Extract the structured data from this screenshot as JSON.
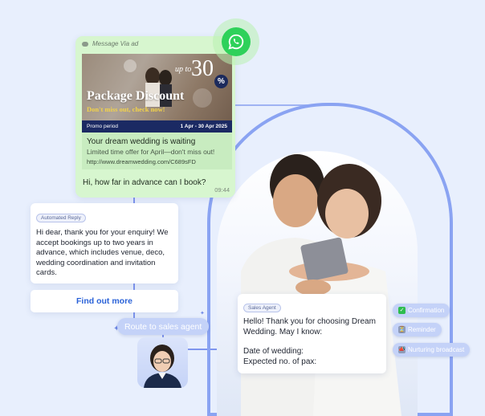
{
  "whatsapp_ad": {
    "header": "Message Via ad",
    "banner": {
      "up_to": "up to",
      "discount_number": "30",
      "discount_symbol": "%",
      "title": "Package Discount",
      "subtitle": "Don't miss out, check now!",
      "promo_label": "Promo period",
      "promo_dates": "1 Apr - 30 Apr 2025"
    },
    "info_title": "Your dream wedding is waiting",
    "info_desc": "Limited time offer for April—don't miss out!",
    "info_url": "http://www.dreamwedding.com/C689sFD",
    "message": "Hi, how far in advance can I book?",
    "time": "09:44"
  },
  "automated_reply": {
    "tag": "Automated Reply",
    "text": "Hi dear, thank you for your enquiry! We accept bookings up to two years in advance, which includes venue, deco, wedding coordination and invitation cards."
  },
  "find_out_more": "Find out more",
  "route_label": "Route to sales agent",
  "sales_agent": {
    "tag": "Sales Agent",
    "line1": "Hello! Thank you for choosing Dream Wedding. May I know:",
    "line2": "Date of wedding:",
    "line3": "Expected no. of pax:"
  },
  "pills": {
    "confirmation": "Confirmation",
    "reminder": "Reminder",
    "nurturing": "Nurturing broadcast"
  },
  "colors": {
    "background": "#e8effd",
    "whatsapp_green": "#2ed15a",
    "chat_green": "#d7f6cf",
    "accent_blue": "#2a62d8",
    "pill_blue": "#c4d2f8"
  },
  "icons": {
    "whatsapp": "whatsapp-icon",
    "confirmation": "check-icon",
    "reminder": "clock-icon",
    "nurturing": "broadcast-icon"
  }
}
